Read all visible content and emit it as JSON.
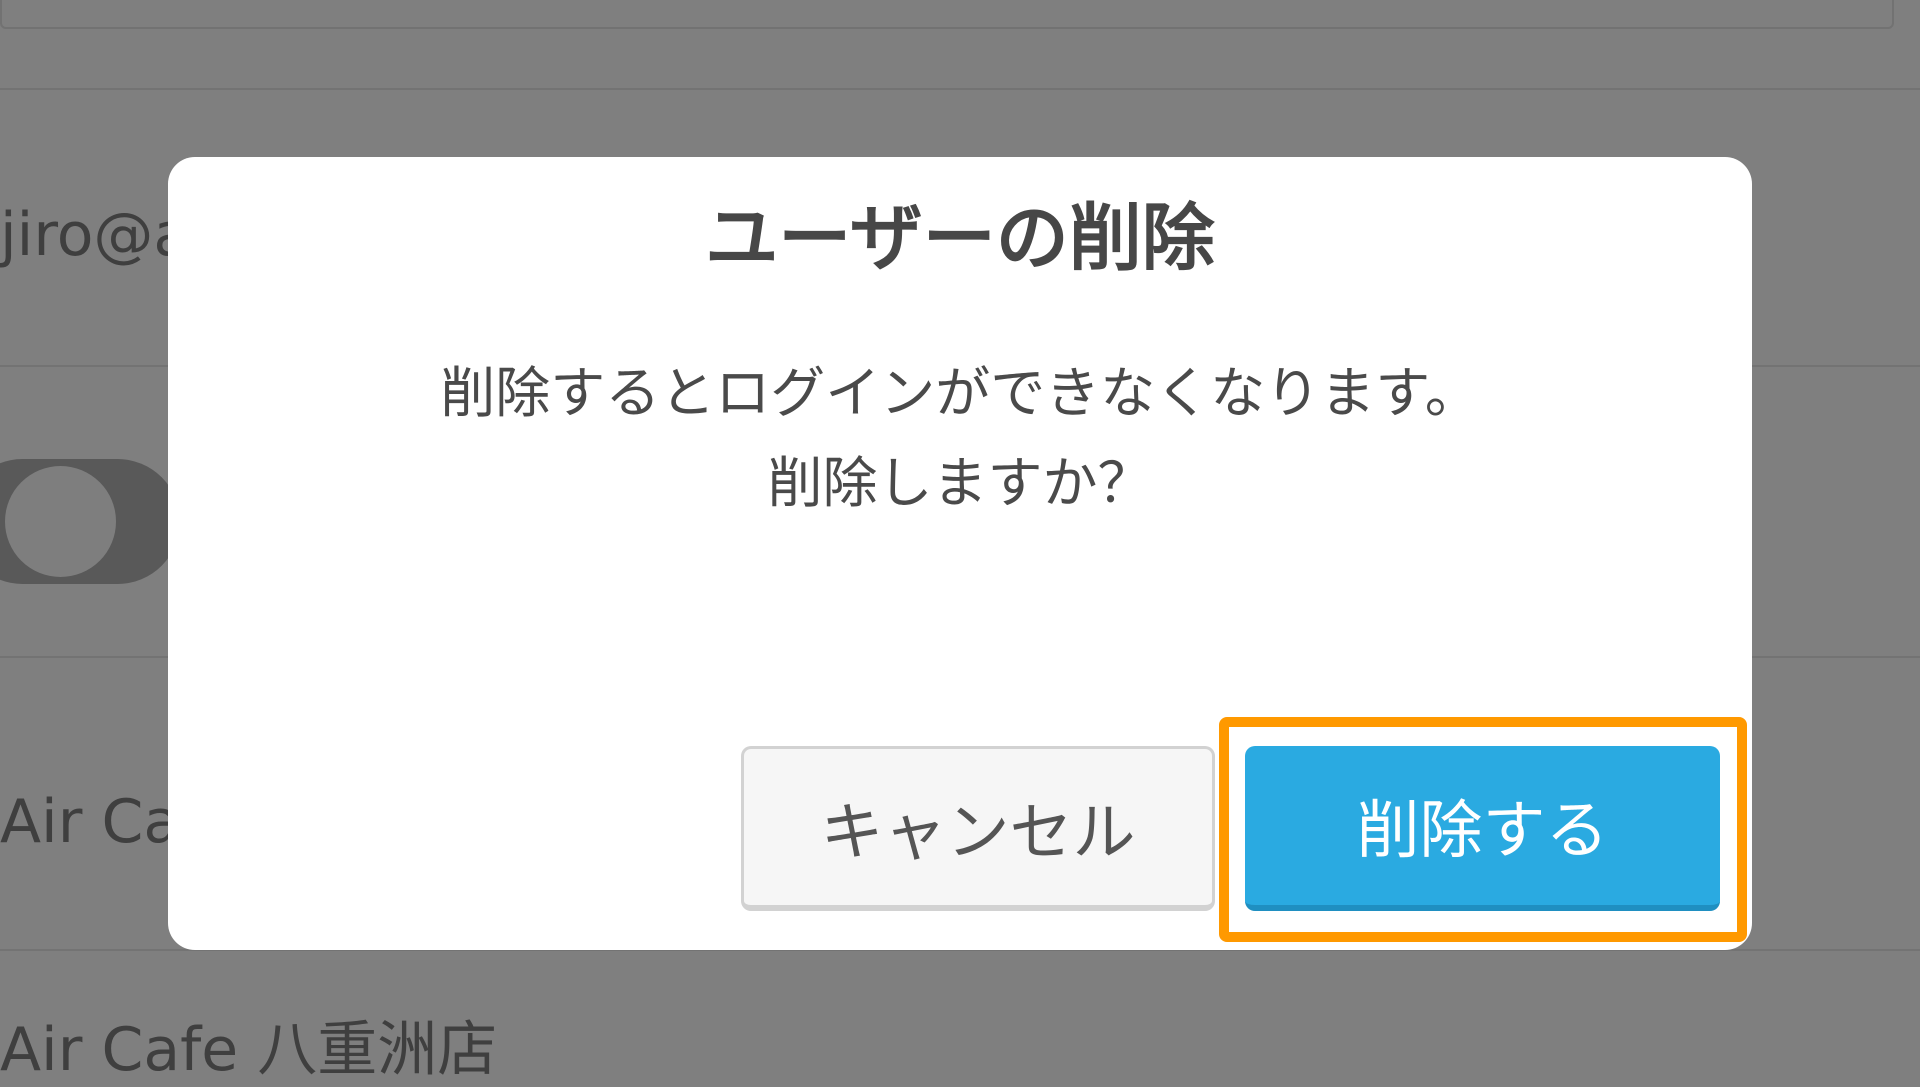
{
  "background": {
    "email_fragment": "jiro@a",
    "store_1_fragment": "Air Ca",
    "store_2": "Air Cafe 八重洲店"
  },
  "dialog": {
    "title": "ユーザーの削除",
    "message_line1": "削除するとログインができなくなります。",
    "message_line2": "削除しますか？",
    "cancel_label": "キャンセル",
    "delete_label": "削除する"
  },
  "colors": {
    "overlay": "#7f7f7f",
    "primary_button": "#2aaae1",
    "highlight": "#ff9900"
  }
}
